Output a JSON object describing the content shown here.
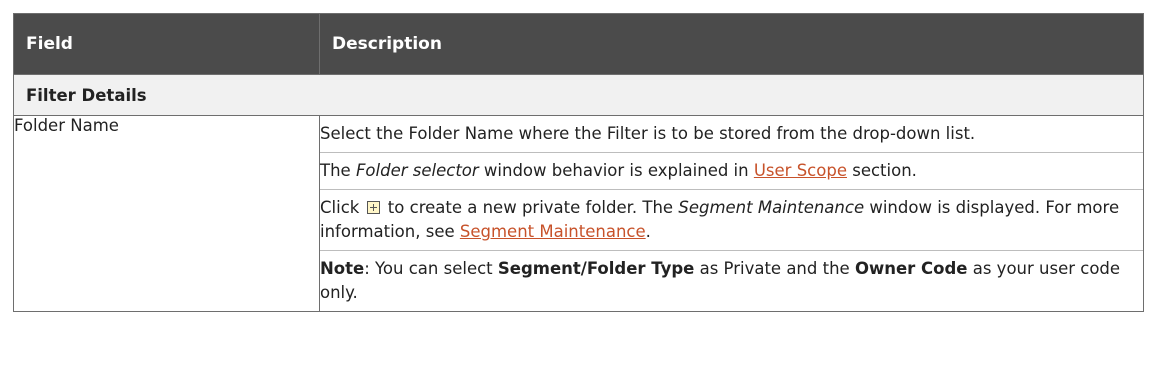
{
  "header": {
    "field": "Field",
    "description": "Description"
  },
  "section": {
    "title": "Filter Details"
  },
  "row": {
    "field": "Folder Name",
    "p1": "Select the Folder Name where the Filter is to be stored from the drop-down list.",
    "p2": {
      "pre": "The ",
      "em": "Folder selector",
      "mid": " window behavior is explained in ",
      "link": "User Scope",
      "post": " section."
    },
    "p3": {
      "pre": "Click ",
      "icon": "add-folder-icon",
      "mid": " to create a new private folder. The ",
      "em": "Segment Maintenance",
      "mid2": " window is displayed. For more information, see ",
      "link": "Segment Maintenance",
      "post": "."
    },
    "p4": {
      "label": "Note",
      "t1": ": You can select ",
      "b1": "Segment/Folder Type",
      "t2": " as Private and the ",
      "b2": "Owner Code",
      "t3": " as your user code only."
    }
  },
  "colors": {
    "header_bg": "#4b4b4b",
    "section_bg": "#f1f1f1",
    "link": "#c7522a"
  }
}
